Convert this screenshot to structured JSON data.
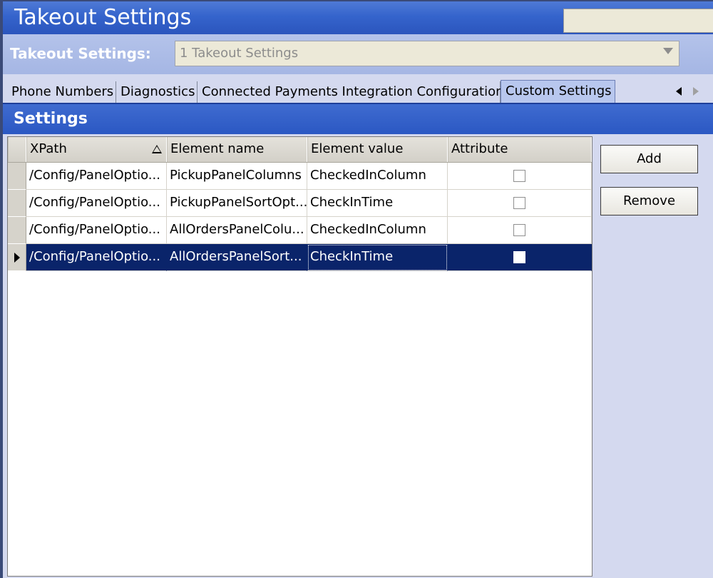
{
  "window": {
    "title": "Takeout Settings"
  },
  "selector": {
    "label": "Takeout Settings:",
    "value": "1 Takeout Settings"
  },
  "tabs": [
    {
      "label": "Phone Numbers",
      "active": false
    },
    {
      "label": "Diagnostics",
      "active": false
    },
    {
      "label": "Connected Payments Integration Configuration",
      "active": false
    },
    {
      "label": "Custom Settings",
      "active": true
    }
  ],
  "panel": {
    "title": "Settings"
  },
  "grid": {
    "columns": [
      "XPath",
      "Element name",
      "Element value",
      "Attribute"
    ],
    "sort_column": "XPath",
    "rows": [
      {
        "xpath": "/Config/PanelOptio...",
        "element_name": "PickupPanelColumns",
        "element_value": "CheckedInColumn",
        "attribute": false,
        "selected": false
      },
      {
        "xpath": "/Config/PanelOptio...",
        "element_name": "PickupPanelSortOpt...",
        "element_value": "CheckInTime",
        "attribute": false,
        "selected": false
      },
      {
        "xpath": "/Config/PanelOptio...",
        "element_name": "AllOrdersPanelColu...",
        "element_value": "CheckedInColumn",
        "attribute": false,
        "selected": false
      },
      {
        "xpath": "/Config/PanelOptio...",
        "element_name": "AllOrdersPanelSort...",
        "element_value": "CheckInTime",
        "attribute": false,
        "selected": true
      }
    ]
  },
  "buttons": {
    "add": "Add",
    "remove": "Remove"
  },
  "colors": {
    "title_bar": "#3564cc",
    "selection": "#0a246a"
  }
}
